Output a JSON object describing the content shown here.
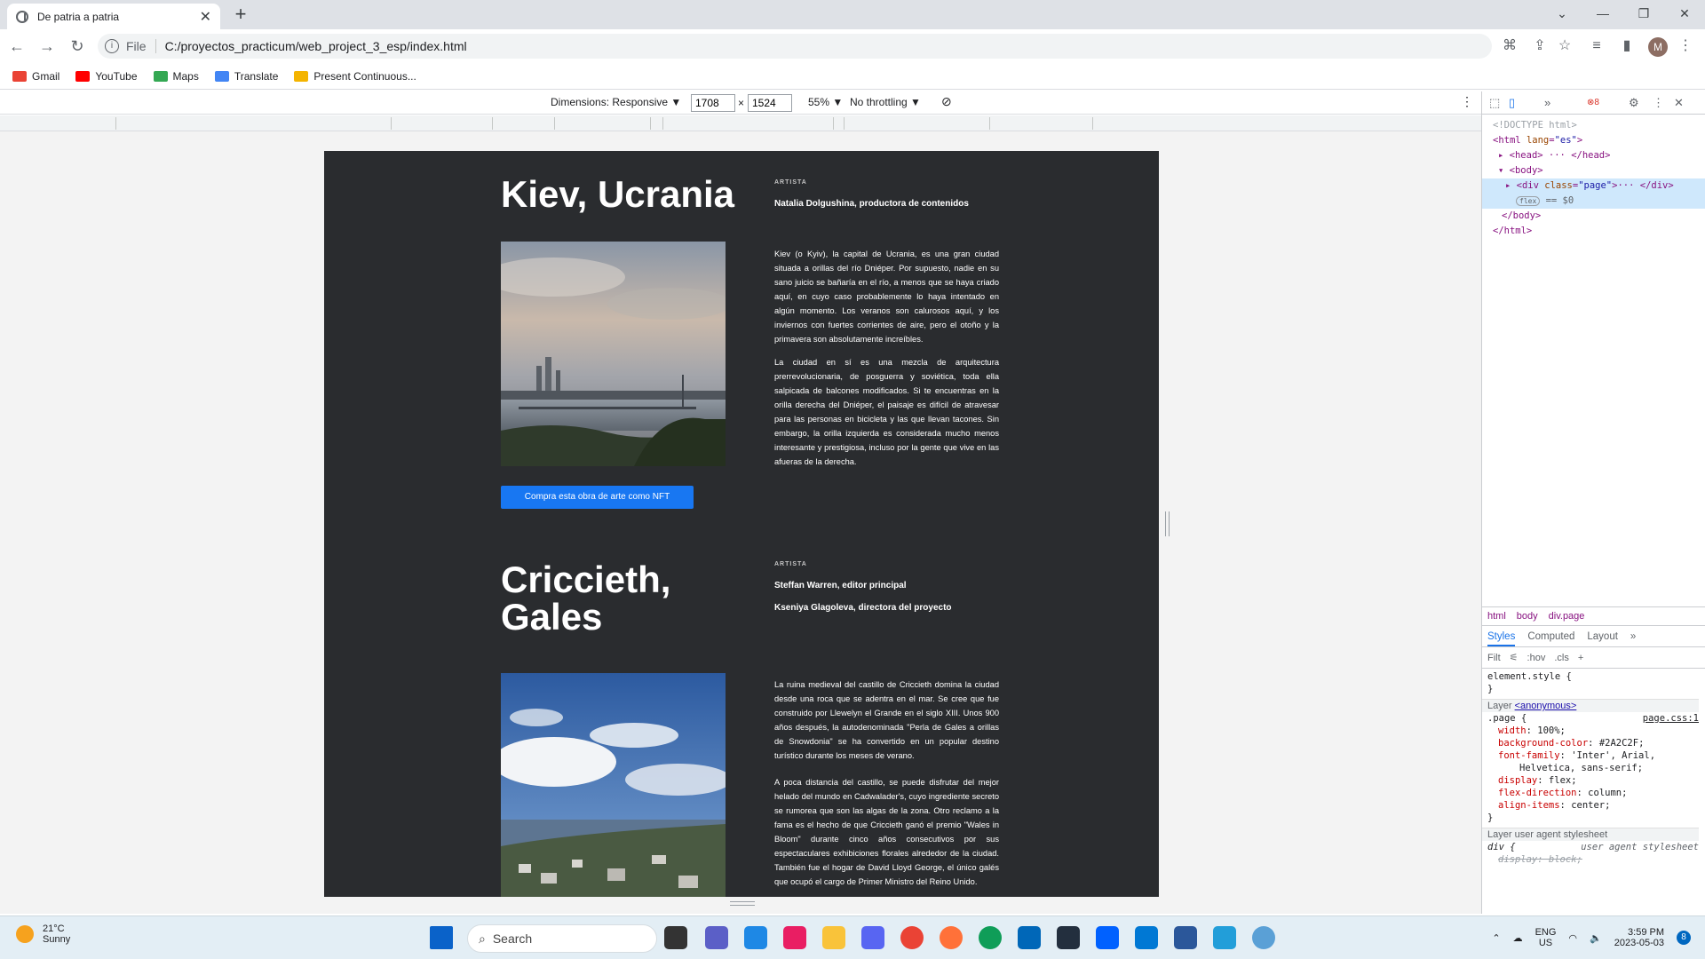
{
  "browser": {
    "tab_title": "De patria a patria",
    "scheme_label": "File",
    "url": "C:/proyectos_practicum/web_project_3_esp/index.html",
    "profile_initial": "M",
    "bookmarks": [
      "Gmail",
      "YouTube",
      "Maps",
      "Translate",
      "Present Continuous..."
    ]
  },
  "device_toolbar": {
    "dimensions_label": "Dimensions: Responsive ▼",
    "width": "1708",
    "height": "1524",
    "zoom": "55% ▼",
    "throttling": "No throttling ▼"
  },
  "page": {
    "sections": [
      {
        "title": "Kiev, Ucrania",
        "artist_label": "ARTISTA",
        "artists": [
          "Natalia Dolgushina, productora de contenidos"
        ],
        "paragraphs": [
          "Kiev (o Kyiv), la capital de Ucrania, es una gran ciudad situada a orillas del río Dniéper. Por supuesto, nadie en su sano juicio se bañaría en el río, a menos que se haya criado aquí, en cuyo caso probablemente lo haya intentado en algún momento. Los veranos son calurosos aquí, y los inviernos con fuertes corrientes de aire, pero el otoño y la primavera son absolutamente increíbles.",
          "La ciudad en sí es una mezcla de arquitectura prerrevolucionaria, de posguerra y soviética, toda ella salpicada de balcones modificados. Si te encuentras en la orilla derecha del Dniéper, el paisaje es difícil de atravesar para las personas en bicicleta y las que llevan tacones. Sin embargo, la orilla izquierda es considerada mucho menos interesante y prestigiosa, incluso por la gente que vive en las afueras de la derecha."
        ],
        "button": "Compra esta obra de arte como NFT"
      },
      {
        "title": "Criccieth, Gales",
        "artist_label": "ARTISTA",
        "artists": [
          "Steffan Warren, editor principal",
          "Kseniya Glagoleva, directora del proyecto"
        ],
        "paragraphs": [
          "La ruina medieval del castillo de Criccieth domina la ciudad desde una roca que se adentra en el mar. Se cree que fue construido por Llewelyn el Grande en el siglo XIII. Unos 900 años después, la autodenominada \"Perla de Gales a orillas de Snowdonia\" se ha convertido en un popular destino turístico durante los meses de verano.",
          "A poca distancia del castillo, se puede disfrutar del mejor helado del mundo en Cadwalader's, cuyo ingrediente secreto se rumorea que son las algas de la zona. Otro reclamo a la fama es el hecho de que Criccieth ganó el premio \"Wales in Bloom\" durante cinco años consecutivos por sus espectaculares exhibiciones florales alrededor de la ciudad. También fue el hogar de David Lloyd George, el único galés que ocupó el cargo de Primer Ministro del Reino Unido."
        ]
      }
    ]
  },
  "devtools": {
    "error_count": "8",
    "dom": {
      "doctype": "<!DOCTYPE html>",
      "html_open_tag": "html",
      "lang_attr": "lang",
      "lang_val": "\"es\"",
      "head": "<head> ··· </head>",
      "body_open": "<body>",
      "div_tag": "div",
      "class_attr": "class",
      "class_val": "\"page\"",
      "div_close": "··· </div>",
      "flex_badge": "flex",
      "eq": "== $0",
      "body_close": "</body>",
      "html_close": "</html>"
    },
    "breadcrumbs": [
      "html",
      "body",
      "div.page"
    ],
    "style_tabs": [
      "Styles",
      "Computed",
      "Layout"
    ],
    "filter_placeholder": "Filt",
    "filter_tools": [
      ":hov",
      ".cls",
      "+"
    ],
    "styles": {
      "element_style": "element.style {",
      "close": "}",
      "layer_label": "Layer",
      "layer_link": "<anonymous>",
      "selector": ".page {",
      "source": "page.css:1",
      "props": [
        [
          "width",
          "100%;"
        ],
        [
          "background-color",
          "#2A2C2F;"
        ],
        [
          "font-family",
          "'Inter', Arial,"
        ],
        [
          "",
          "Helvetica, sans-serif;"
        ],
        [
          "display",
          "flex;"
        ],
        [
          "flex-direction",
          "column;"
        ],
        [
          "align-items",
          "center;"
        ]
      ],
      "ua_label": "Layer user agent stylesheet",
      "ua_selector": "div {",
      "ua_source": "user agent stylesheet",
      "ua_prop": "display: block;"
    }
  },
  "taskbar": {
    "temp": "21°C",
    "condition": "Sunny",
    "search": "Search",
    "lang1": "ENG",
    "lang2": "US",
    "time": "3:59 PM",
    "date": "2023-05-03",
    "notif_count": "8"
  }
}
